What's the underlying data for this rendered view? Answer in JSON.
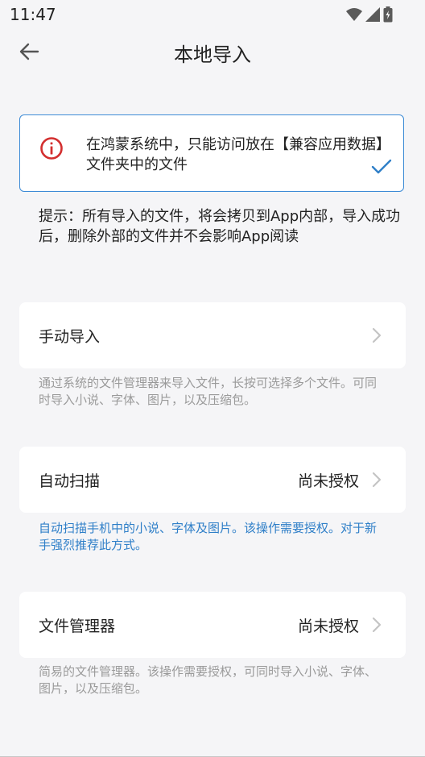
{
  "status_bar": {
    "time": "11:47",
    "icons": [
      "wifi-icon",
      "signal-icon",
      "battery-icon"
    ]
  },
  "header": {
    "title": "本地导入",
    "back_icon": "back-arrow-icon"
  },
  "notice": {
    "text": "在鸿蒙系统中，只能访问放在【兼容应用数据】文件夹中的文件",
    "icon": "info-icon",
    "check_icon": "check-icon",
    "colors": {
      "border": "#3d8bd6",
      "icon": "#d32f2f",
      "check": "#2f7fc8"
    }
  },
  "tip": "提示：所有导入的文件，将会拷贝到App内部，导入成功后，删除外部的文件并不会影响App阅读",
  "options": [
    {
      "label": "手动导入",
      "status": "",
      "description": "通过系统的文件管理器来导入文件，长按可选择多个文件。可同时导入小说、字体、图片，以及压缩包。"
    },
    {
      "label": "自动扫描",
      "status": "尚未授权",
      "description": "自动扫描手机中的小说、字体及图片。该操作需要授权。对于新手强烈推荐此方式。"
    },
    {
      "label": "文件管理器",
      "status": "尚未授权",
      "description": "简易的文件管理器。该操作需要授权，可同时导入小说、字体、图片，以及压缩包。"
    }
  ],
  "colors": {
    "accent": "#2f7fc8",
    "muted_text": "#9a9a9a",
    "background": "#f5f5f7"
  }
}
